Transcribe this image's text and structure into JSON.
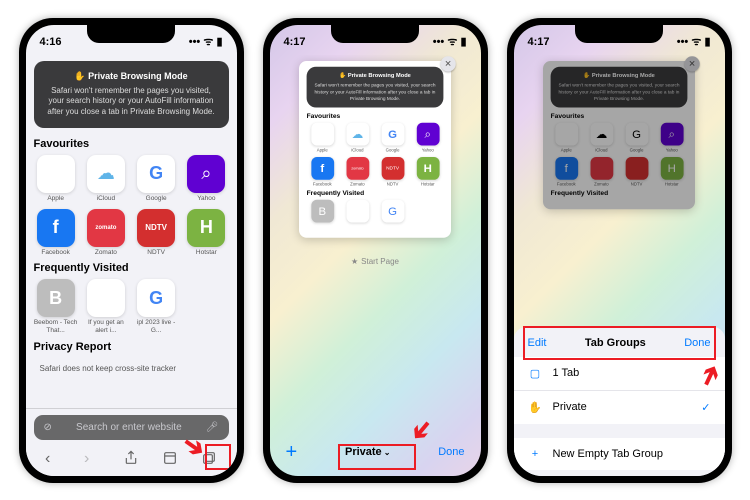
{
  "statusbar": {
    "time1": "4:16",
    "time2": "4:17",
    "time3": "4:17",
    "signal": "▪▪▪▪",
    "wifi": "📶",
    "battery": "■"
  },
  "banner": {
    "title": "✋ Private Browsing Mode",
    "desc": "Safari won't remember the pages you visited, your search history or your AutoFill information after you close a tab in Private Browsing Mode."
  },
  "sections": {
    "favourites": "Favourites",
    "frequently": "Frequently Visited",
    "privacy": "Privacy Report"
  },
  "fav": [
    {
      "name": "Apple",
      "glyph": "",
      "bg": "#fff",
      "col": "#333"
    },
    {
      "name": "iCloud",
      "glyph": "☁︎",
      "bg": "#fff",
      "col": "#5fb4e8"
    },
    {
      "name": "Google",
      "glyph": "G",
      "bg": "#fff",
      "col": "#4285f4"
    },
    {
      "name": "Yahoo",
      "glyph": "🔍",
      "bg": "#6001d2",
      "col": "#fff"
    },
    {
      "name": "Facebook",
      "glyph": "f",
      "bg": "#1877f2",
      "col": "#fff"
    },
    {
      "name": "Zomato",
      "glyph": "zomato",
      "bg": "#e23744",
      "col": "#fff"
    },
    {
      "name": "NDTV",
      "glyph": "NDTV",
      "bg": "#d32f2f",
      "col": "#fff"
    },
    {
      "name": "Hotstar",
      "glyph": "H",
      "bg": "#7cb342",
      "col": "#fff"
    }
  ],
  "freq": [
    {
      "name": "Beebom - Tech That...",
      "glyph": "B",
      "bg": "#bdbdbd"
    },
    {
      "name": "If you get an alert i...",
      "glyph": "",
      "bg": "#fff"
    },
    {
      "name": "ipl 2023 live - G...",
      "glyph": "G",
      "bg": "#fff"
    }
  ],
  "privacy_text": "Safari does not keep cross-site tracker",
  "search": {
    "placeholder": "Search or enter website"
  },
  "startpage": "Start Page",
  "tabbar": {
    "private": "Private",
    "done": "Done",
    "plus": "+"
  },
  "sheet": {
    "edit": "Edit",
    "title": "Tab Groups",
    "done": "Done",
    "row1": "1 Tab",
    "row2": "Private",
    "row3": "New Empty Tab Group"
  }
}
